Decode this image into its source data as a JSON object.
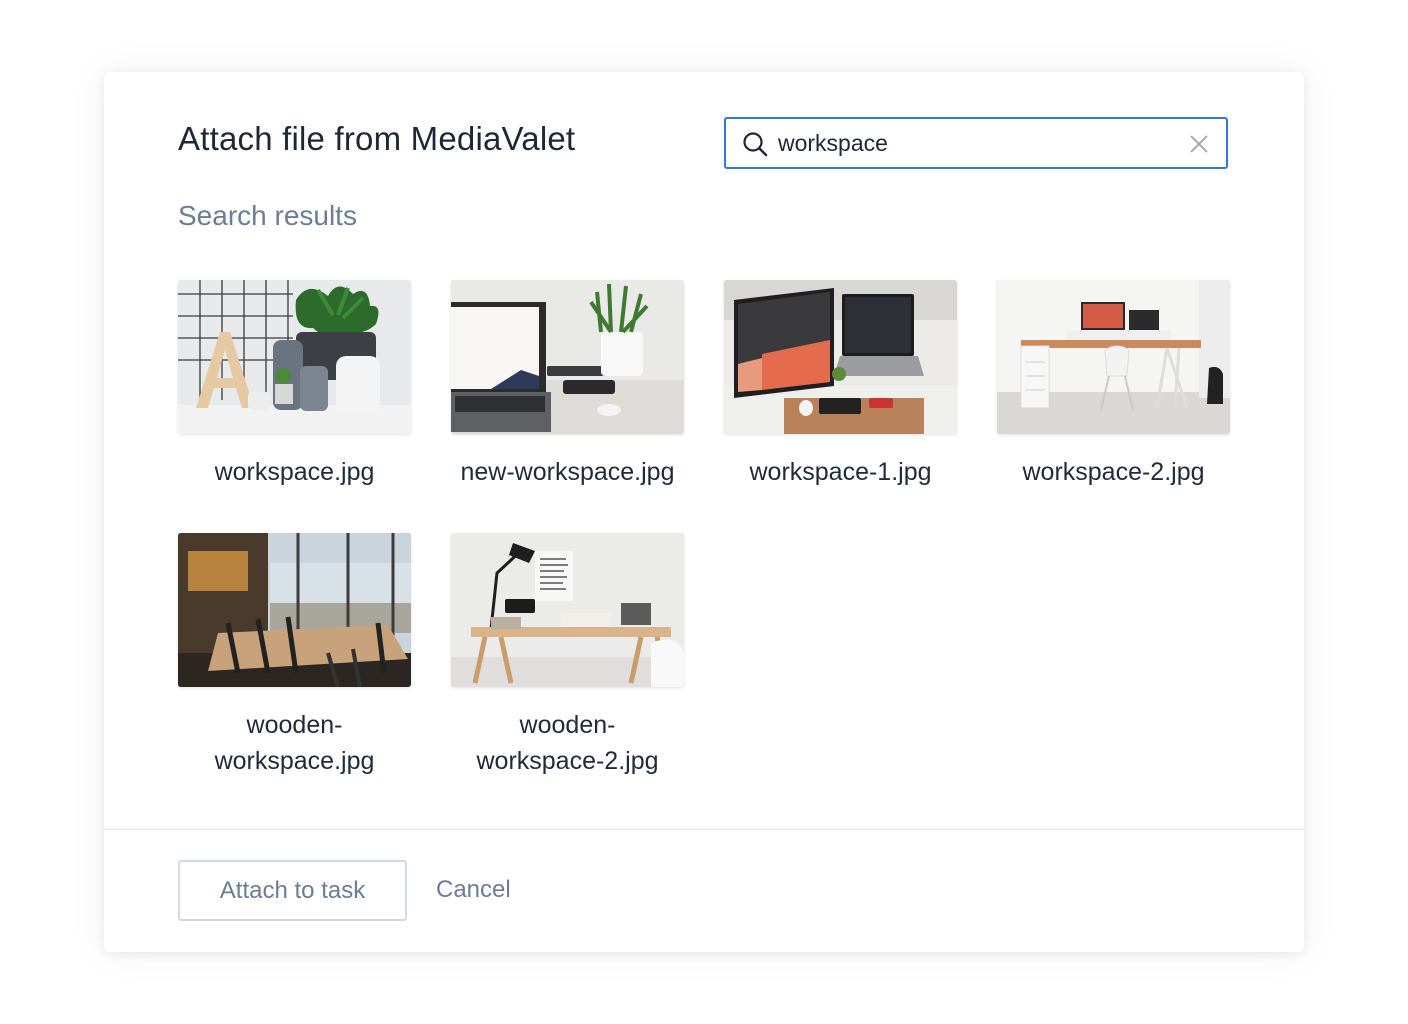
{
  "dialog": {
    "title": "Attach file from MediaValet",
    "search": {
      "value": "workspace",
      "placeholder": ""
    },
    "subtitle": "Search results",
    "files": [
      {
        "name": "workspace.jpg"
      },
      {
        "name": "new-workspace.jpg"
      },
      {
        "name": "workspace-1.jpg"
      },
      {
        "name": "workspace-2.jpg"
      },
      {
        "name": "wooden-workspace.jpg",
        "line1": "wooden-",
        "line2": "workspace.jpg"
      },
      {
        "name": "wooden-workspace-2.jpg",
        "line1": "wooden-",
        "line2": "workspace-2.jpg"
      }
    ],
    "attach_label": "Attach to task",
    "cancel_label": "Cancel"
  },
  "colors": {
    "accent": "#2f7ad8",
    "muted_text": "#6b7d96",
    "text": "#1d2735"
  }
}
